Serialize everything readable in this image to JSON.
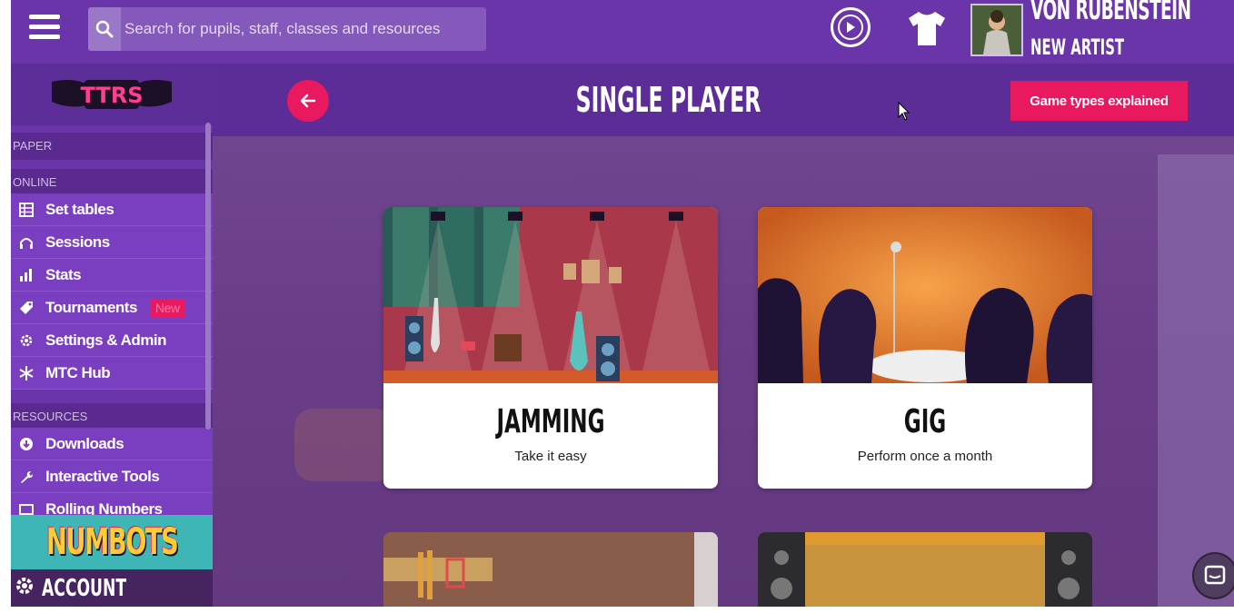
{
  "topbar": {
    "search": {
      "placeholder": "Search for pupils, staff, classes and resources",
      "value": ""
    },
    "user": {
      "name": "VON RUBENSTEIN",
      "rank": "NEW ARTIST"
    }
  },
  "sidebar": {
    "logo_text": "TTRS",
    "sections": [
      {
        "label": "PAPER"
      },
      {
        "label": "ONLINE"
      },
      {
        "label": "RESOURCES"
      }
    ],
    "online_items": [
      {
        "label": "Set tables",
        "icon": "table-icon"
      },
      {
        "label": "Sessions",
        "icon": "headphones-icon"
      },
      {
        "label": "Stats",
        "icon": "bar-chart-icon"
      },
      {
        "label": "Tournaments",
        "icon": "tag-icon",
        "badge": "New"
      },
      {
        "label": "Settings & Admin",
        "icon": "gear-icon"
      },
      {
        "label": "MTC Hub",
        "icon": "star-icon"
      }
    ],
    "resource_items": [
      {
        "label": "Downloads",
        "icon": "download-icon"
      },
      {
        "label": "Interactive Tools",
        "icon": "wrench-icon"
      },
      {
        "label": "Rolling Numbers",
        "icon": "numbers-icon"
      }
    ],
    "numbots": "NUMBOTS",
    "account": "ACCOUNT"
  },
  "header": {
    "title": "SINGLE PLAYER",
    "explained_button": "Game types explained"
  },
  "cards": [
    {
      "title": "JAMMING",
      "subtitle": "Take it easy"
    },
    {
      "title": "GIG",
      "subtitle": "Perform once a month"
    }
  ],
  "colors": {
    "brand_purple": "#6a35a8",
    "accent_pink": "#e9195f"
  }
}
